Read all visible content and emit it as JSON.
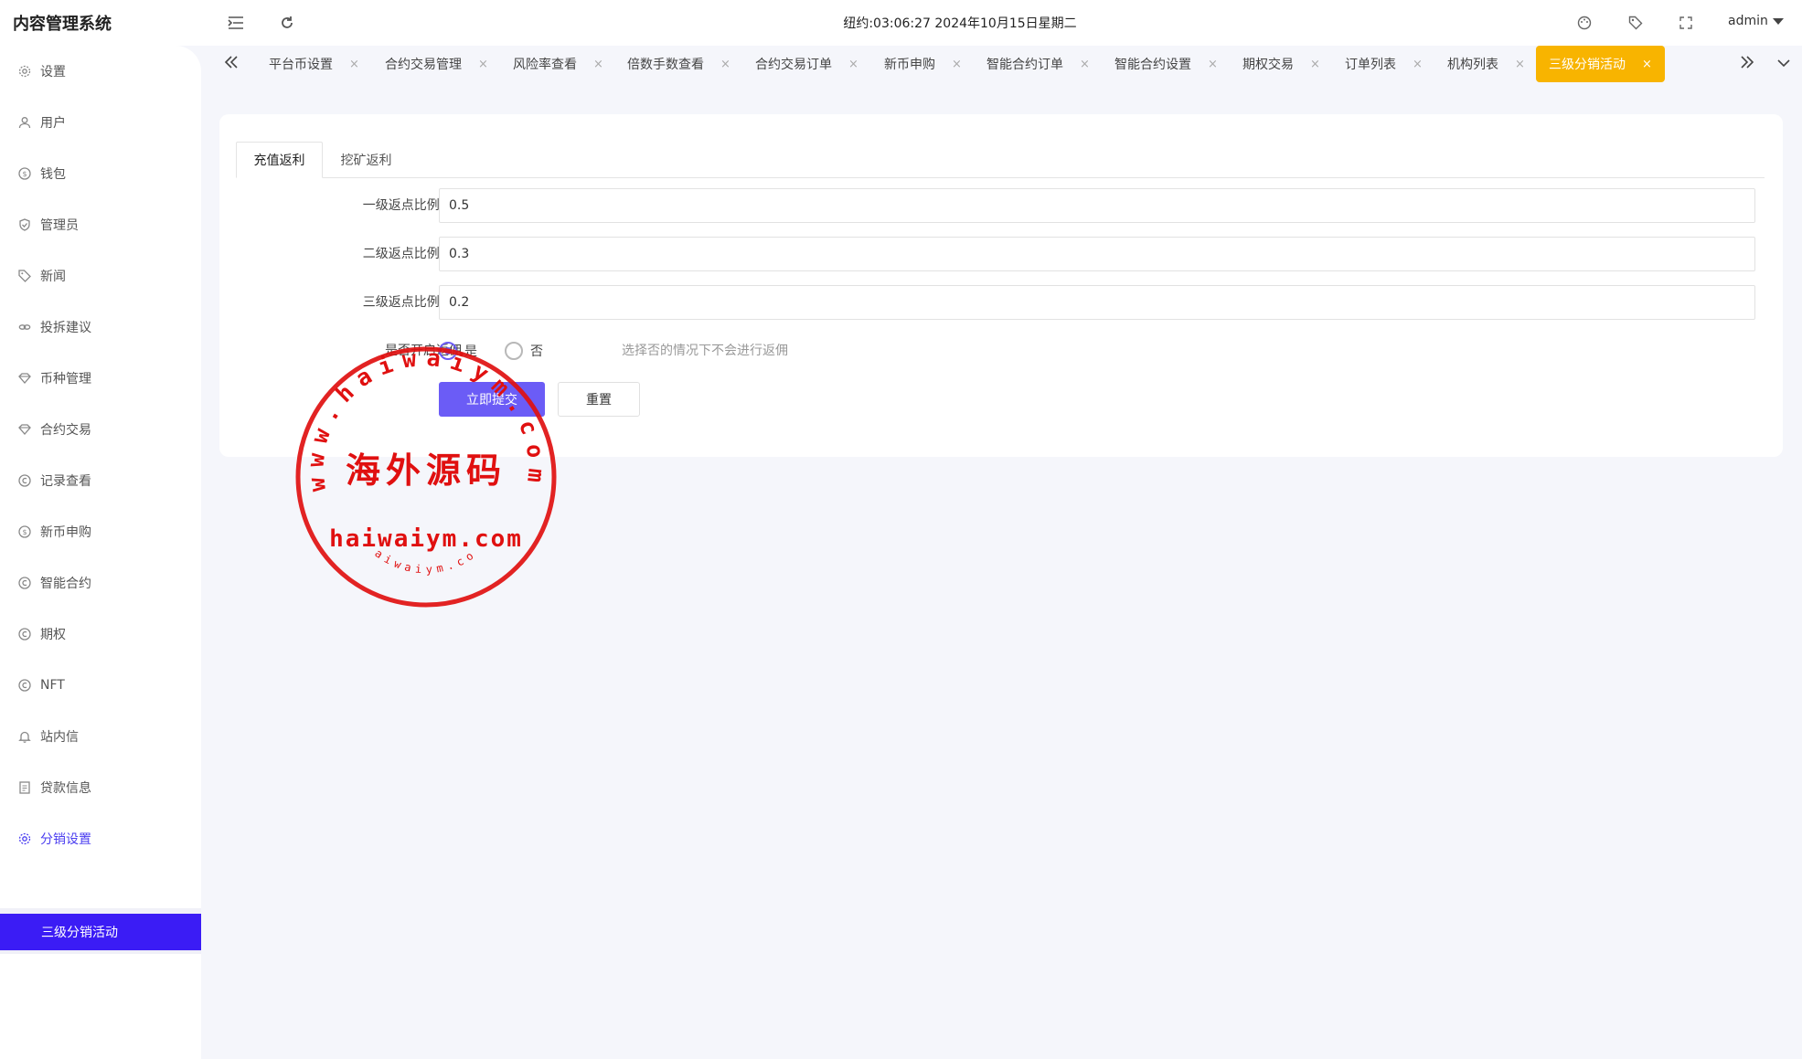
{
  "header": {
    "app_title": "内容管理系统",
    "datetime": "纽约:03:06:27 2024年10月15日星期二",
    "user": "admin",
    "icons": [
      "menu-fold-icon",
      "refresh-icon",
      "theme-icon",
      "tag-icon",
      "fullscreen-icon"
    ]
  },
  "sidebar": {
    "items": [
      {
        "label": "设置",
        "icon": "gear-icon"
      },
      {
        "label": "用户",
        "icon": "user-icon"
      },
      {
        "label": "钱包",
        "icon": "dollar-icon"
      },
      {
        "label": "管理员",
        "icon": "shield-check-icon"
      },
      {
        "label": "新闻",
        "icon": "tag-icon"
      },
      {
        "label": "投拆建议",
        "icon": "link-icon"
      },
      {
        "label": "币种管理",
        "icon": "diamond-icon"
      },
      {
        "label": "合约交易",
        "icon": "diamond-icon"
      },
      {
        "label": "记录查看",
        "icon": "circle-c-icon"
      },
      {
        "label": "新币申购",
        "icon": "dollar-icon"
      },
      {
        "label": "智能合约",
        "icon": "circle-c-icon"
      },
      {
        "label": "期权",
        "icon": "circle-c-icon"
      },
      {
        "label": "NFT",
        "icon": "circle-c-icon"
      },
      {
        "label": "站内信",
        "icon": "bell-icon"
      },
      {
        "label": "贷款信息",
        "icon": "document-icon"
      },
      {
        "label": "分销设置",
        "icon": "gear-icon"
      }
    ],
    "active_sub": "三级分销活动"
  },
  "tabs": [
    {
      "label": "平台币设置"
    },
    {
      "label": "合约交易管理"
    },
    {
      "label": "风险率查看"
    },
    {
      "label": "倍数手数查看"
    },
    {
      "label": "合约交易订单"
    },
    {
      "label": "新币申购"
    },
    {
      "label": "智能合约订单"
    },
    {
      "label": "智能合约设置"
    },
    {
      "label": "期权交易"
    },
    {
      "label": "订单列表"
    },
    {
      "label": "机构列表"
    },
    {
      "label": "三级分销活动",
      "active": true
    }
  ],
  "tab_close": "×",
  "form": {
    "subtabs": [
      "充值返利",
      "挖矿返利"
    ],
    "fields": [
      {
        "label": "一级返点比例(%)",
        "value": "0.5"
      },
      {
        "label": "二级返点比例(%)",
        "value": "0.3"
      },
      {
        "label": "三级返点比例(%)",
        "value": "0.2"
      }
    ],
    "toggle": {
      "label": "是否开启返佣",
      "options": [
        "是",
        "否"
      ],
      "selected": "是",
      "hint": "选择否的情况下不会进行返佣"
    },
    "submit_label": "立即提交",
    "reset_label": "重置"
  },
  "watermark": {
    "top_text": "www.haiwaiym.com",
    "center_text": "海外源码",
    "domain_text": "haiwaiym.com",
    "bottom_text": "haiwaiym.com",
    "color": "#e01010"
  },
  "colors": {
    "accent": "#6b5cf6",
    "active_sidebar": "#3b1cf5",
    "active_tab": "#f8b400"
  }
}
